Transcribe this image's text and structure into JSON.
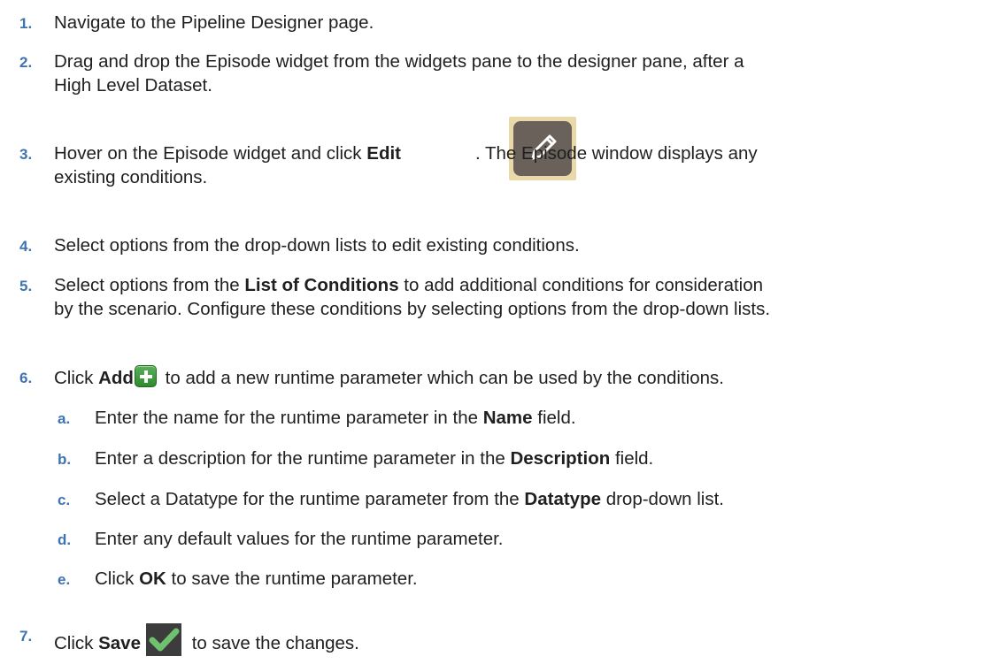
{
  "steps": [
    {
      "num": "1.",
      "text": "Navigate to the Pipeline Designer page."
    },
    {
      "num": "2.",
      "text_line1": "Drag and drop the Episode widget from the widgets pane to the designer pane, after a",
      "text_line2": "High Level Dataset."
    },
    {
      "num": "3.",
      "pre": "Hover on the Episode widget and click ",
      "bold": "Edit",
      "post": ". The Episode window displays any",
      "line2": "existing conditions.",
      "icon": "pencil-edit-icon"
    },
    {
      "num": "4.",
      "text": "Select options from the drop-down lists to edit existing conditions."
    },
    {
      "num": "5.",
      "pre": "Select options from the ",
      "bold": "List of Conditions",
      "post": " to add additional conditions for consideration",
      "line2": "by the scenario. Configure these conditions by selecting options from the drop-down lists."
    },
    {
      "num": "6.",
      "pre": "Click ",
      "bold": "Add",
      "post": " to add a new runtime parameter which can be used by the conditions.",
      "icon": "add-plus-icon"
    },
    {
      "num": "7.",
      "pre": "Click ",
      "bold": "Save",
      "post": " to save the changes.",
      "icon": "save-check-icon"
    }
  ],
  "substeps": [
    {
      "num": "a.",
      "pre": "Enter the name for the runtime parameter in the ",
      "bold": "Name",
      "post": " field."
    },
    {
      "num": "b.",
      "pre": "Enter a description for the runtime parameter in the ",
      "bold": "Description",
      "post": " field."
    },
    {
      "num": "c.",
      "pre": "Select a Datatype for the runtime parameter from the ",
      "bold": "Datatype",
      "post": " drop-down list."
    },
    {
      "num": "d.",
      "text": "Enter any default values for the runtime parameter."
    },
    {
      "num": "e.",
      "pre": "Click ",
      "bold": "OK",
      "post": " to save the runtime parameter."
    }
  ],
  "colors": {
    "step_number": "#3e73b0",
    "text": "#1f1f1f",
    "edit_icon_bg": "#6a625a",
    "edit_icon_border": "#e9d9a9",
    "add_icon": "#3a9a3a",
    "save_icon_bg": "#3c3c3c",
    "save_check": "#6fc06f"
  }
}
